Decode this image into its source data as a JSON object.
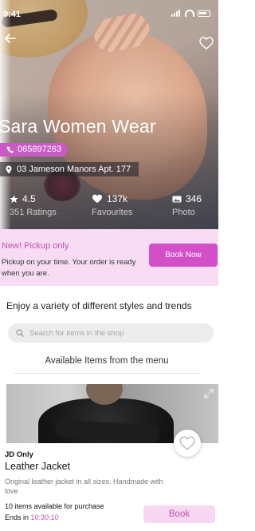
{
  "status_bar": {
    "time": "9:41"
  },
  "shop": {
    "name": "Sara Women Wear",
    "phone": "065897263",
    "address": "03 Jameson Manors Apt. 177"
  },
  "stats": {
    "rating_value": "4.5",
    "rating_label": "351 Ratings",
    "favourites_value": "137k",
    "favourites_label": "Favourites",
    "photo_value": "346",
    "photo_label": "Photo"
  },
  "pickup": {
    "title": "New! Pickup only",
    "description": "Pickup on your time. Your order is ready when you are.",
    "button_label": "Book Now"
  },
  "enjoy_text": "Enjoy a variety of different styles and trends",
  "search": {
    "placeholder": "Search for items in the shop"
  },
  "menu_heading": "Available Items from the menu",
  "product": {
    "badge": "JD Only",
    "name": "Leather Jacket",
    "description": "Original leather jacket in all sizes. Handmade with love",
    "availability": "10 items available for purchase",
    "ends_label": "Ends in",
    "ends_time": "10:30:10",
    "book_label": "Book"
  },
  "colors": {
    "accent": "#d34fc8",
    "accent_light": "#f7dcf3",
    "phone_chip": "#c95bc4"
  },
  "icons": [
    "back-arrow-icon",
    "heart-outline-icon",
    "location-pin-icon",
    "phone-icon",
    "star-icon",
    "heart-icon",
    "photo-icon",
    "search-icon",
    "expand-icon"
  ]
}
